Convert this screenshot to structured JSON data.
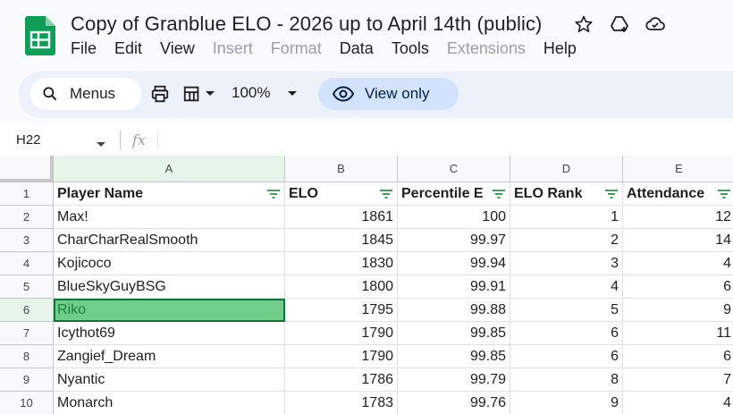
{
  "title_bar": {
    "doc_title": "Copy of Granblue ELO  - 2026 up to April 14th (public)",
    "icons": [
      "star-icon",
      "move-to-drive-icon",
      "cloud-status-icon"
    ]
  },
  "menu": {
    "items": [
      {
        "label": "File",
        "disabled": false
      },
      {
        "label": "Edit",
        "disabled": false
      },
      {
        "label": "View",
        "disabled": false
      },
      {
        "label": "Insert",
        "disabled": true
      },
      {
        "label": "Format",
        "disabled": true
      },
      {
        "label": "Data",
        "disabled": false
      },
      {
        "label": "Tools",
        "disabled": false
      },
      {
        "label": "Extensions",
        "disabled": true
      },
      {
        "label": "Help",
        "disabled": false
      }
    ]
  },
  "toolbar": {
    "search_label": "Menus",
    "zoom": "100%",
    "view_only_label": "View only"
  },
  "formula_bar": {
    "name_box": "H22",
    "fx": "fx",
    "content": ""
  },
  "grid": {
    "columns": [
      "A",
      "B",
      "C",
      "D",
      "E"
    ],
    "rows": [
      "1",
      "2",
      "3",
      "4",
      "5",
      "6",
      "7",
      "8",
      "9",
      "10"
    ],
    "headers": [
      "Player Name",
      "ELO",
      "Percentile E",
      "ELO Rank",
      "Attendance"
    ],
    "data": [
      [
        "Max!",
        "1861",
        "100",
        "1",
        "12"
      ],
      [
        "CharCharRealSmooth",
        "1845",
        "99.97",
        "2",
        "14"
      ],
      [
        "Kojicoco",
        "1830",
        "99.94",
        "3",
        "4"
      ],
      [
        "BlueSkyGuyBSG",
        "1800",
        "99.91",
        "4",
        "6"
      ],
      [
        "Riko",
        "1795",
        "99.88",
        "5",
        "9"
      ],
      [
        "Icythot69",
        "1790",
        "99.85",
        "6",
        "11"
      ],
      [
        "Zangief_Dream",
        "1790",
        "99.85",
        "6",
        "6"
      ],
      [
        "Nyantic",
        "1786",
        "99.79",
        "8",
        "7"
      ],
      [
        "Monarch",
        "1783",
        "99.76",
        "9",
        "4"
      ]
    ],
    "selected_cell": "A6"
  },
  "colors": {
    "accent": "#1a73e8",
    "selection_fill": "#6fcf8a",
    "selection_border": "#137333",
    "header_highlight": "#e6f4ea",
    "sheets_green": "#0f9d58"
  }
}
